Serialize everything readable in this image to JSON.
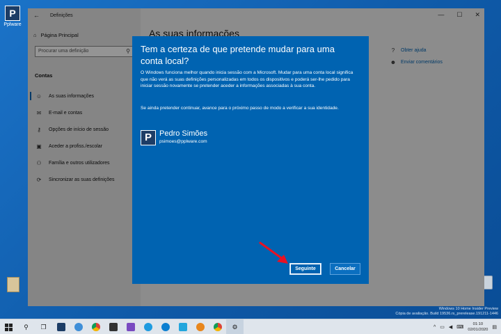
{
  "desktop": {
    "icons": [
      {
        "label": "Pplware",
        "glyph": "P"
      },
      {
        "label": "",
        "glyph": ""
      },
      {
        "label": "",
        "glyph": ""
      }
    ]
  },
  "settings": {
    "title": "Definições",
    "home": "Página Principal",
    "search_placeholder": "Procurar uma definição",
    "section": "Contas",
    "nav": [
      {
        "label": "As suas informações",
        "icon": "person-icon"
      },
      {
        "label": "E-mail e contas",
        "icon": "mail-icon"
      },
      {
        "label": "Opções de início de sessão",
        "icon": "key-icon"
      },
      {
        "label": "Aceder a profiss./escolar",
        "icon": "briefcase-icon"
      },
      {
        "label": "Família e outros utilizadores",
        "icon": "people-icon"
      },
      {
        "label": "Sincronizar as suas definições",
        "icon": "sync-icon"
      }
    ],
    "heading": "As suas informações",
    "help": [
      "Obter ajuda",
      "Enviar comentários"
    ]
  },
  "dialog": {
    "title": "Tem a certeza de que pretende mudar para uma conta local?",
    "p1": "O Windows funciona melhor quando inicia sessão com a Microsoft. Mudar para uma conta local significa que não verá as suas definições personalizadas em todos os dispositivos e poderá ser-lhe pedido para iniciar sessão novamente se pretender aceder a informações associadas à sua conta.",
    "p2": "Se ainda pretender continuar, avance para o próximo passo de modo a verificar a sua identidade.",
    "account": {
      "name": "Pedro Simões",
      "email": "psimoes@pplware.com",
      "avatar_glyph": "P"
    },
    "next_label": "Seguinte",
    "cancel_label": "Cancelar"
  },
  "watermark": {
    "line1": "Windows 10 Home Insider Preview",
    "line2": "Cópia de avaliação. Build 19536.rs_prerelease.191211-1446"
  },
  "taskbar": {
    "time": "01:10",
    "date": "02/01/2020"
  },
  "colors": {
    "dialog_bg": "#0063b1",
    "accent": "#0063b1",
    "arrow": "#e81123"
  }
}
